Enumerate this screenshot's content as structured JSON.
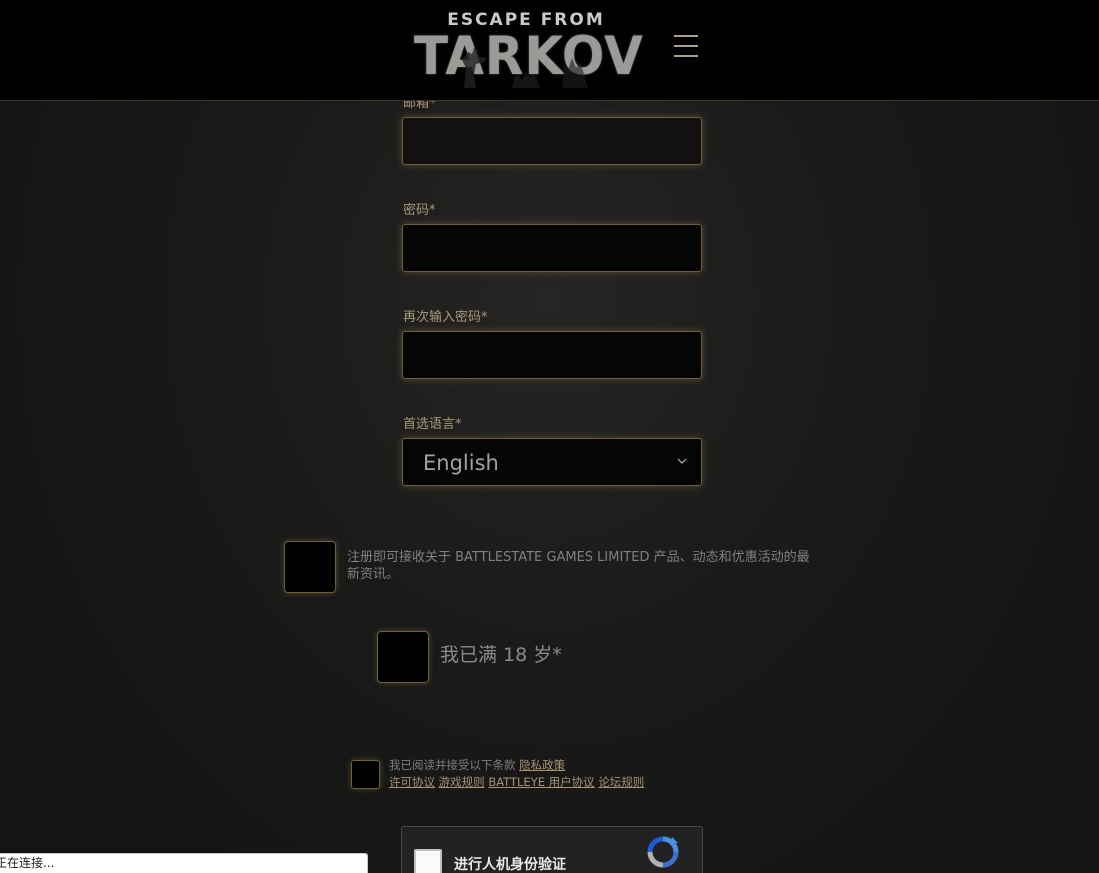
{
  "header": {
    "logo_top": "ESCAPE FROM",
    "logo_main": "TARKOV",
    "menu_icon": "hamburger-menu-icon"
  },
  "form": {
    "email_label": "邮箱*",
    "password_label": "密码*",
    "password_confirm_label": "再次输入密码*",
    "language_label": "首选语言*",
    "language_value": "English"
  },
  "consents": {
    "news_text": "注册即可接收关于 BATTLESTATE GAMES LIMITED 产品、动态和优惠活动的最新资讯。",
    "age_text": "我已满 18 岁*",
    "terms_prefix": "我已阅读并接受以下条款",
    "privacy_policy": "隐私政策",
    "license_agreement": "许可协议",
    "game_rules": "游戏规则",
    "battleye_agreement": "BATTLEYE 用户协议",
    "forum_rules": "论坛规则"
  },
  "recaptcha": {
    "label": "进行人机身份验证",
    "logo_icon": "recaptcha-icon"
  },
  "status_bar": {
    "text": "正在连接..."
  },
  "colors": {
    "accent": "#a89877",
    "border_glow": "#6d5e3d",
    "link": "#a89272",
    "background": "#1b1b1a"
  }
}
